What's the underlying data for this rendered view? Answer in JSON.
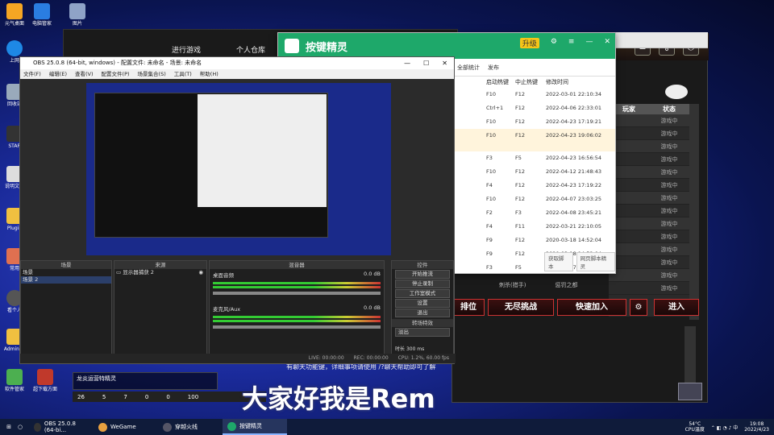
{
  "desktop_icons": [
    {
      "label": "元气桌面",
      "color": "#f5a623"
    },
    {
      "label": "电脑管家",
      "color": "#2a7de1"
    },
    {
      "label": "图片",
      "color": "#8fa3c7"
    },
    {
      "label": "上网",
      "color": "#1e88e5"
    },
    {
      "label": "回收站",
      "color": "#9ab"
    },
    {
      "label": "STAR",
      "color": "#333"
    },
    {
      "label": "说明文档",
      "color": "#ddd"
    },
    {
      "label": "Plugin",
      "color": "#f0c040"
    },
    {
      "label": "常用",
      "color": "#e07050"
    },
    {
      "label": "看个人",
      "color": "#555"
    },
    {
      "label": "Administ",
      "color": "#f0c040"
    },
    {
      "label": "软件管家",
      "color": "#4caf50"
    },
    {
      "label": "超下载方面",
      "color": "#c0392b"
    }
  ],
  "taskbar": {
    "items": [
      {
        "label": "OBS 25.0.8 (64-bi...",
        "color": "#333"
      },
      {
        "label": "WeGame",
        "color": "#e8a040"
      },
      {
        "label": "穿越火线",
        "color": "#556"
      },
      {
        "label": "按键精灵",
        "color": "#1ea86a"
      }
    ],
    "temp": "54°C",
    "temp_label": "CPU温度",
    "time": "19:08",
    "date": "2022/4/23"
  },
  "obs": {
    "title": "OBS 25.0.8 (64-bit, windows) - 配置文件: 未命名 - 场景: 未命名",
    "menu": [
      "文件(F)",
      "编辑(E)",
      "查看(V)",
      "配置文件(P)",
      "场景集合(S)",
      "工具(T)",
      "帮助(H)"
    ],
    "docks": {
      "scenes": {
        "title": "场景",
        "items": [
          "场景",
          "场景 2"
        ]
      },
      "sources": {
        "title": "来源",
        "items": [
          "显示器捕获 2"
        ]
      },
      "mixer": {
        "title": "混音器",
        "tracks": [
          {
            "name": "桌面音频",
            "db": "0.0 dB"
          },
          {
            "name": "麦克风/Aux",
            "db": "0.0 dB"
          }
        ]
      },
      "controls": {
        "title": "控件",
        "buttons": [
          "开始推流",
          "停止录制",
          "工作室模式",
          "设置",
          "退出"
        ]
      },
      "transition": {
        "title": "转场特效",
        "value": "淡出",
        "duration_label": "时长",
        "duration": "300 ms"
      }
    },
    "status": {
      "live": "LIVE: 00:00:00",
      "rec": "REC: 00:00:00",
      "cpu": "CPU: 1.2%, 60.00 fps"
    }
  },
  "anjian": {
    "title": "按键精灵",
    "upgrade": "升级",
    "toolbar": [
      "全部统计",
      "发布"
    ],
    "columns": [
      "启动热键",
      "中止热键",
      "修改时间"
    ],
    "rows": [
      [
        "F10",
        "F12",
        "2022-03-01 22:10:34"
      ],
      [
        "Ctrl+1",
        "F12",
        "2022-04-06 22:33:01"
      ],
      [
        "F10",
        "F12",
        "2022-04-23 17:19:21"
      ],
      [
        "F10",
        "F12",
        "2022-04-23 19:06:02"
      ],
      [
        "F3",
        "F5",
        "2022-04-23 16:56:54"
      ],
      [
        "F10",
        "F12",
        "2022-04-12 21:48:43"
      ],
      [
        "F4",
        "F12",
        "2022-04-23 17:19:22"
      ],
      [
        "F10",
        "F12",
        "2022-04-07 23:03:25"
      ],
      [
        "F2",
        "F3",
        "2022-04-08 23:45:21"
      ],
      [
        "F4",
        "F11",
        "2022-03-21 22:10:05"
      ],
      [
        "F9",
        "F12",
        "2020-03-18 14:52:04"
      ],
      [
        "F9",
        "F12",
        "2020-03-18 14:52:04"
      ],
      [
        "F3",
        "F5",
        "2022-04-07 00:05:57"
      ]
    ],
    "footer": [
      "获取脚本",
      "网页脚本精灵"
    ]
  },
  "game": {
    "top_labels": [
      "进行游戏",
      "个人仓库"
    ],
    "table_headers": [
      "玩家",
      "状态"
    ],
    "table_rows": [
      "游戏中",
      "游戏中",
      "游戏中",
      "游戏中",
      "游戏中",
      "游戏中",
      "游戏中",
      "游戏中",
      "游戏中",
      "游戏中",
      "游戏中",
      "游戏中",
      "游戏中",
      "游戏中"
    ],
    "buttons": [
      "排位",
      "无尽挑战",
      "快速加入",
      "进入"
    ],
    "mode_labels": [
      "刺杀(猎手)",
      "惩罚之都"
    ],
    "chat": "有聊天功能键，详细事项请使用 /?聊天帮助即可了解",
    "notice": "龙炎运营特精灵",
    "bar_values": [
      "26",
      "5",
      "7",
      "0",
      "0",
      "100"
    ]
  },
  "watermark": "大家好我是Rem"
}
